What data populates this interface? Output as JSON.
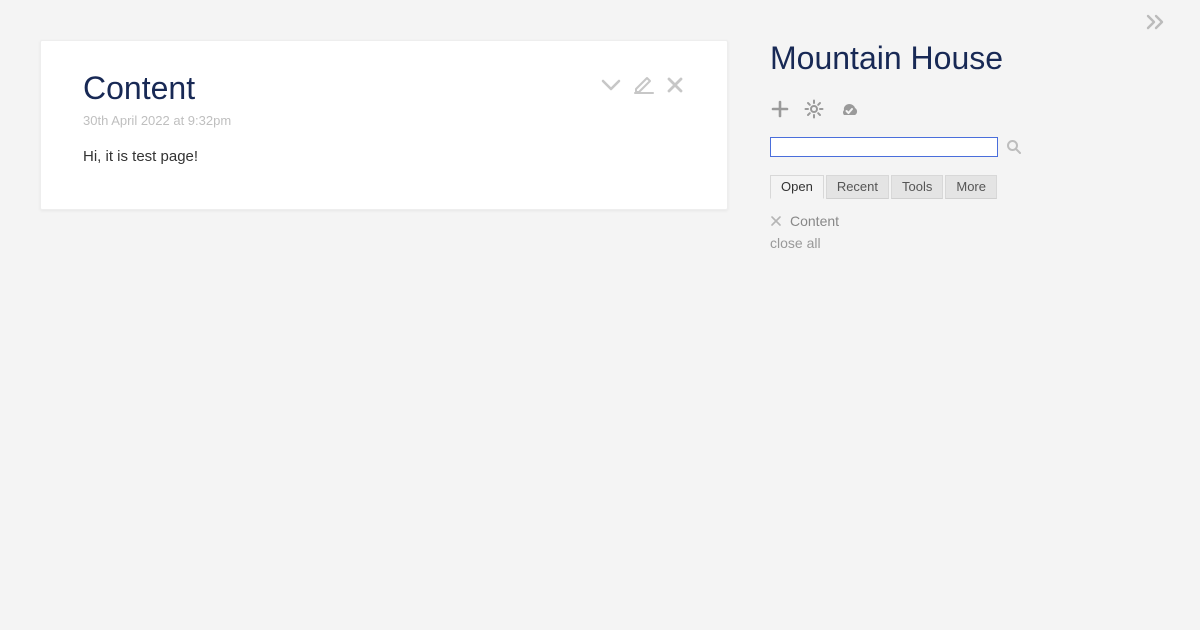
{
  "tiddler": {
    "title": "Content",
    "subtitle": "30th April 2022 at 9:32pm",
    "body": "Hi, it is test page!"
  },
  "sidebar": {
    "site_title": "Mountain House",
    "search_value": "",
    "tabs": [
      "Open",
      "Recent",
      "Tools",
      "More"
    ],
    "active_tab": "Open",
    "open_items": [
      {
        "label": "Content"
      }
    ],
    "close_all_label": "close all"
  }
}
